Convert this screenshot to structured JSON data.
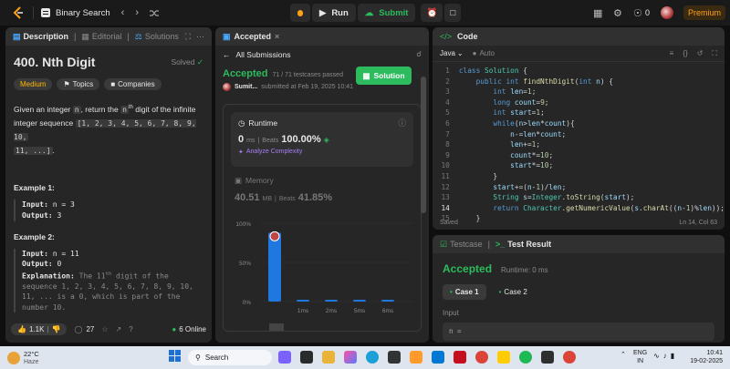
{
  "topbar": {
    "title": "Binary Search",
    "run_label": "Run",
    "submit_label": "Submit",
    "streak": "0",
    "premium_label": "Premium"
  },
  "left": {
    "tabs": [
      "Description",
      "Editorial",
      "Solutions"
    ],
    "problem_title": "400. Nth Digit",
    "solved_label": "Solved",
    "difficulty": "Medium",
    "topics_label": "Topics",
    "companies_label": "Companies",
    "desc_1": "Given an integer",
    "desc_n": "n",
    "desc_2": ", return the",
    "desc_nth": "n",
    "desc_th": "th",
    "desc_3": "digit of the infinite",
    "desc_4": "integer sequence",
    "sequence": "[1, 2, 3, 4, 5, 6, 7, 8, 9, 10,",
    "sequence_2": "11, ...]",
    "desc_end": ".",
    "example1": {
      "title": "Example 1:",
      "input_label": "Input:",
      "input_value": "n = 3",
      "output_label": "Output:",
      "output_value": "3"
    },
    "example2": {
      "title": "Example 2:",
      "input_label": "Input:",
      "input_value": "n = 11",
      "output_label": "Output:",
      "output_value": "0",
      "explanation_label": "Explanation:",
      "explanation_1a": "The 11",
      "explanation_1sup": "th",
      "explanation_1b": "digit of the",
      "explanation_2": "sequence 1, 2, 3, 4, 5, 6, 7, 8, 9, 10,",
      "explanation_3": "11, ... is a 0, which is part of the",
      "explanation_4": "number 10."
    },
    "footer": {
      "likes": "1.1K",
      "comments": "27",
      "online": "6 Online"
    }
  },
  "middle": {
    "tab": "Accepted",
    "all_submissions": "All Submissions",
    "status": "Accepted",
    "testcases": "71 / 71 testcases passed",
    "user": "Sumit...",
    "submitted": "submitted at Feb 19, 2025 10:41",
    "solution_button": "Solution",
    "runtime_label": "Runtime",
    "runtime_value": "0",
    "runtime_unit": "ms",
    "beats_label": "Beats",
    "runtime_beats": "100.00%",
    "analyze_label": "Analyze Complexity",
    "memory_label": "Memory",
    "memory_value": "40.51",
    "memory_unit": "MB",
    "memory_beats": "41.85%",
    "chart_y_labels": [
      "100%",
      "50%",
      "0%"
    ],
    "chart_x_labels": [
      "1ms",
      "2ms",
      "5ms",
      "6ms"
    ]
  },
  "chart_data": {
    "type": "bar",
    "categories": [
      "0ms",
      "1ms",
      "2ms",
      "5ms",
      "6ms"
    ],
    "values": [
      88,
      2,
      2,
      2,
      2
    ],
    "ylim": [
      0,
      100
    ],
    "highlight_index": 0,
    "colors": {
      "highlight": "#1f77e0",
      "other": "#1f77e0"
    }
  },
  "code": {
    "tab": "Code",
    "language": "Java",
    "auto": "Auto",
    "lines": [
      "1",
      "2",
      "3",
      "4",
      "5",
      "6",
      "7",
      "8",
      "9",
      "10",
      "11",
      "12",
      "13",
      "14",
      "15"
    ],
    "saved": "Saved",
    "cursor": "Ln 14, Col 63"
  },
  "result": {
    "tab_testcase": "Testcase",
    "tab_result": "Test Result",
    "status": "Accepted",
    "runtime": "Runtime: 0 ms",
    "case1": "Case 1",
    "case2": "Case 2",
    "input_label": "Input",
    "input_value": "n ="
  },
  "taskbar": {
    "temp": "22°C",
    "weather": "Haze",
    "search": "Search",
    "lang1": "ENG",
    "lang2": "IN",
    "time": "10:41",
    "date": "19-02-2025"
  }
}
